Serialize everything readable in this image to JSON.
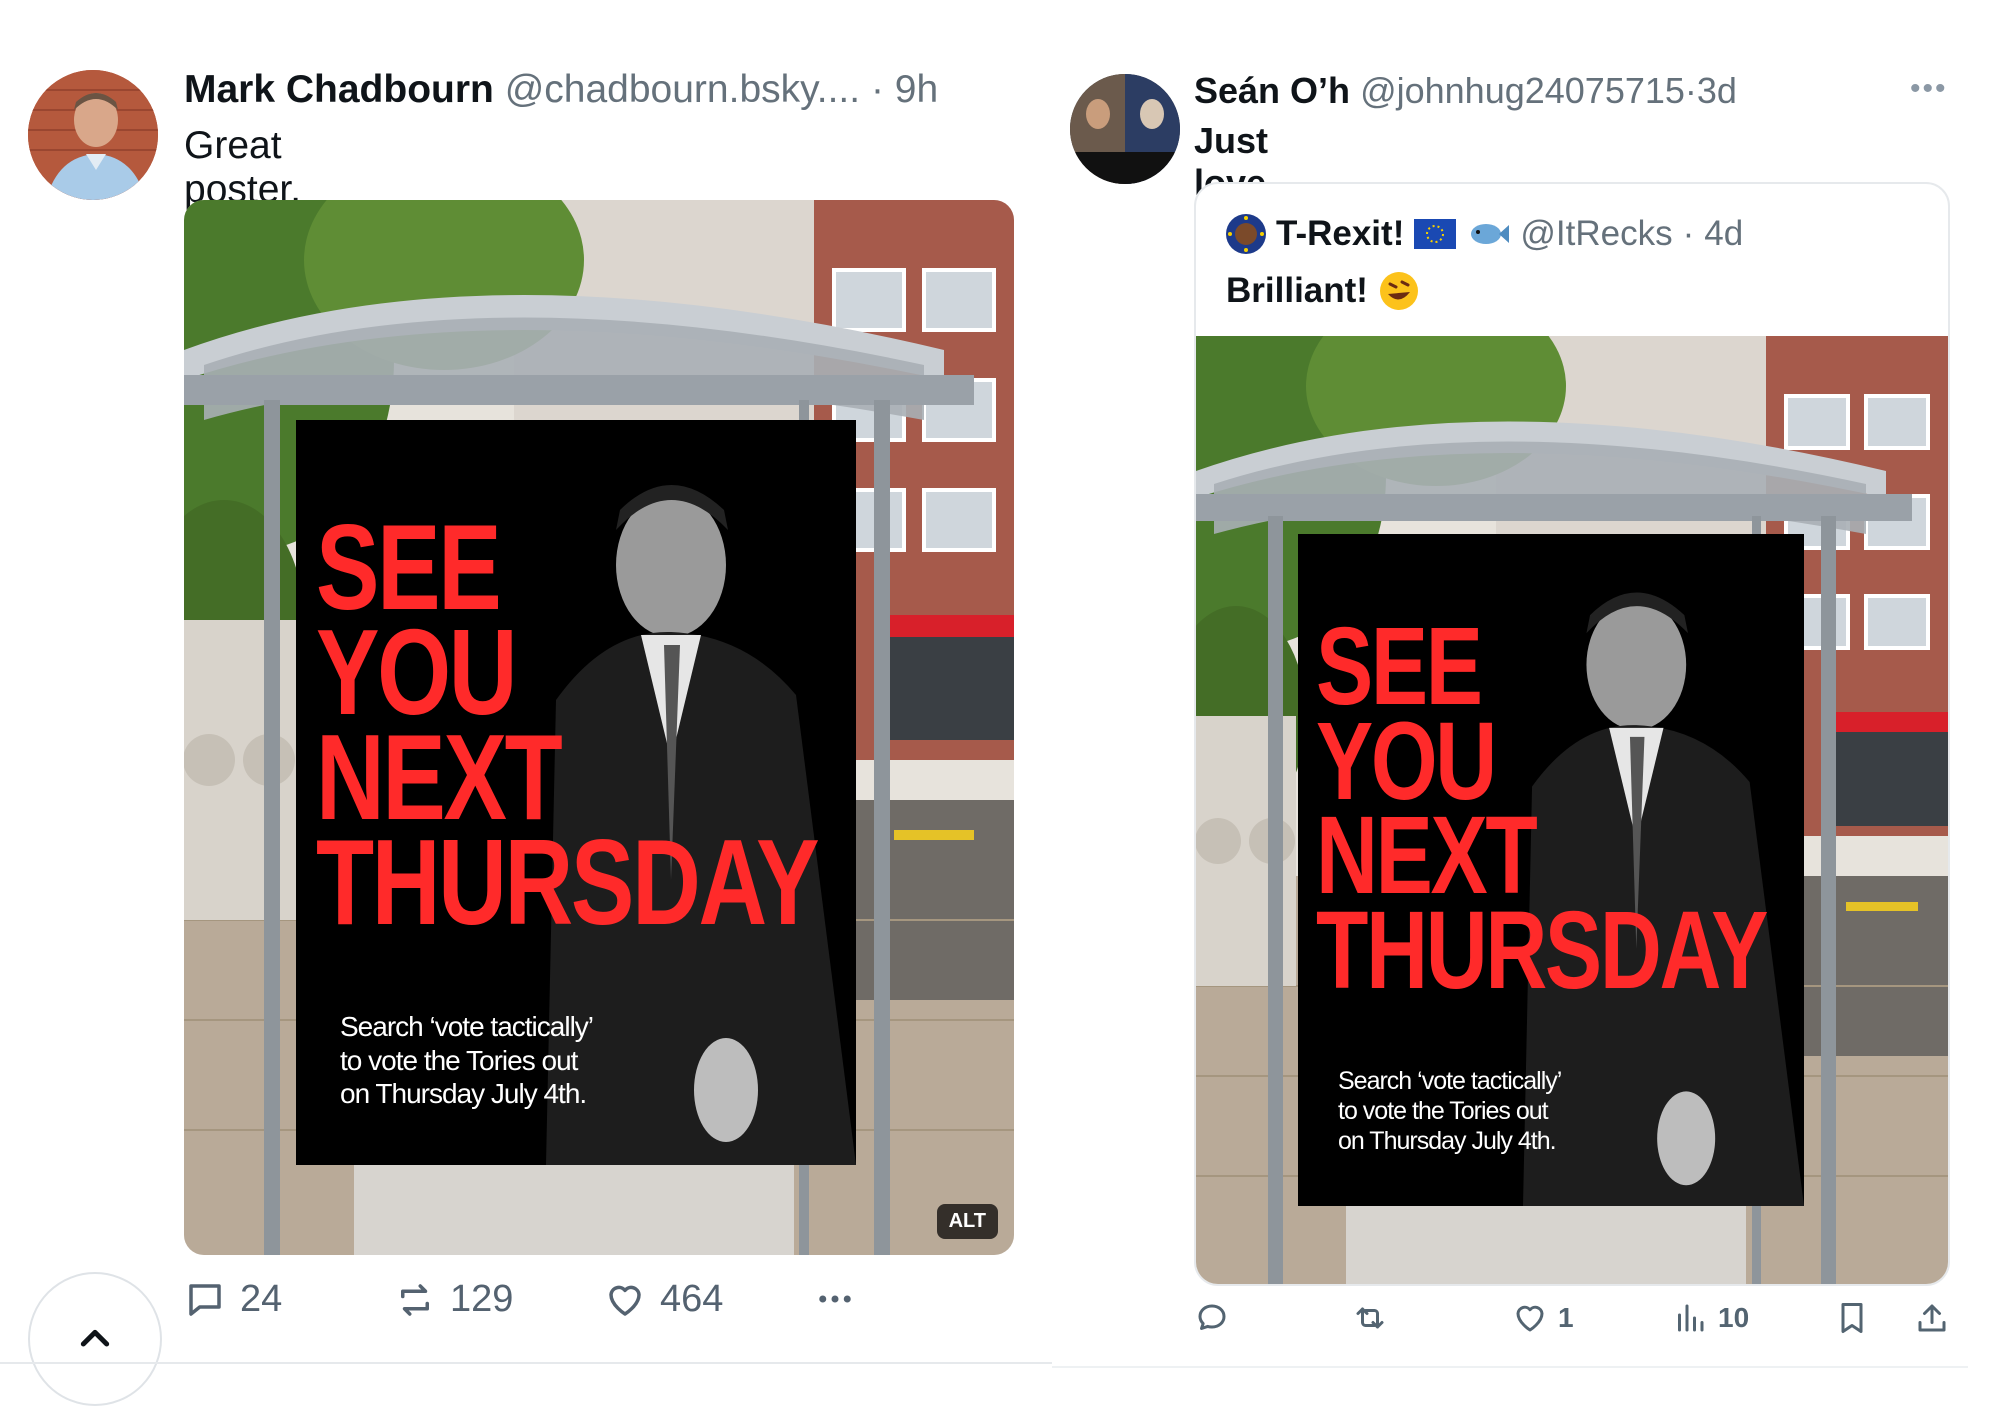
{
  "left_post": {
    "display_name": "Mark Chadbourn",
    "handle": "@chadbourn.bsky....",
    "separator": "·",
    "time": "9h",
    "text": "Great poster.",
    "alt_badge": "ALT",
    "actions": {
      "replies": "24",
      "reposts": "129",
      "likes": "464"
    }
  },
  "right_post": {
    "display_name": "Seán O’h",
    "handle": "@johnhug24075715",
    "separator": "·",
    "time": "3d",
    "text": "Just love this post",
    "quote": {
      "display_name": "T-Rexit!",
      "handle": "@ItRecks",
      "separator": "·",
      "time": "4d",
      "text": "Brilliant!"
    },
    "actions": {
      "likes": "1",
      "views": "10"
    }
  },
  "poster": {
    "headline": [
      "SEE",
      "YOU",
      "NEXT",
      "THURSDAY"
    ],
    "subline": [
      "Search ‘vote tactically’",
      "to vote the Tories out",
      "on Thursday July 4th."
    ]
  },
  "icons": {
    "reply": "speech-bubble-icon",
    "repost": "repost-arrows-icon",
    "like": "heart-icon",
    "more": "more-dots-icon",
    "views": "bar-chart-icon",
    "bookmark": "bookmark-icon",
    "share": "share-upload-icon",
    "scroll_top": "chevron-up-icon"
  },
  "colors": {
    "poster_red": "#ff2a2a",
    "muted_text": "#65717b"
  }
}
